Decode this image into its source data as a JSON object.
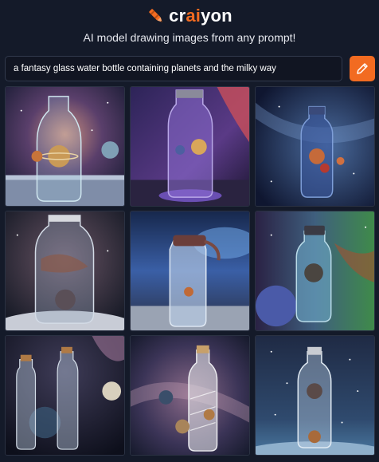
{
  "header": {
    "brand_part1": "cr",
    "brand_part2": "ai",
    "brand_part3": "yon",
    "logo_icon": "crayon-icon",
    "accent_color": "#f26b21"
  },
  "tagline": "AI model drawing images from any prompt!",
  "prompt": {
    "value": "a fantasy glass water bottle containing planets and the milky way",
    "draw_icon": "pencil-icon"
  },
  "results": [
    {
      "id": 1,
      "subject": "glass bottle with ringed planet"
    },
    {
      "id": 2,
      "subject": "purple glass bottle with planets"
    },
    {
      "id": 3,
      "subject": "blue bottle with red planets"
    },
    {
      "id": 4,
      "subject": "jar with swirling galaxy"
    },
    {
      "id": 5,
      "subject": "sport bottle with red cap"
    },
    {
      "id": 6,
      "subject": "blue bottle with large planet"
    },
    {
      "id": 7,
      "subject": "two tall galaxy bottles"
    },
    {
      "id": 8,
      "subject": "frosted bottle with planets"
    },
    {
      "id": 9,
      "subject": "clear bottle with starry sky"
    }
  ]
}
